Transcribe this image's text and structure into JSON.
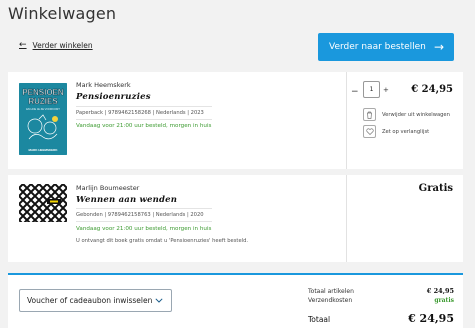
{
  "page": {
    "title": "Winkelwagen"
  },
  "nav": {
    "back_label": "Verder winkelen",
    "checkout_label": "Verder naar bestellen"
  },
  "items": [
    {
      "author": "Mark Heemskerk",
      "title": "Pensioenruzies",
      "meta": "Paperback | 9789462158268 | Nederlands | 2023",
      "delivery": "Vandaag voor 21:00 uur besteld, morgen in huis",
      "quantity": "1",
      "price": "€ 24,95",
      "remove_label": "Verwijder uit winkelwagen",
      "wishlist_label": "Zet op verlanglijst",
      "cover": {
        "line1": "PENSIOEN",
        "line2": "RUZIES",
        "subtitle": "EN HOE JE ZE VOORKOMT",
        "author": "MARK HEEMSKERK",
        "color": "#1c88a0"
      }
    },
    {
      "author": "Marlijn Boumeester",
      "title": "Wennen aan wenden",
      "meta": "Gebonden | 9789462158763 | Nederlands | 2020",
      "delivery": "Vandaag voor 21:00 uur besteld, morgen in huis",
      "price": "Gratis",
      "note": "U ontvangt dit boek gratis omdat u 'Pensioenruzies' heeft besteld."
    }
  ],
  "summary": {
    "voucher_label": "Voucher of cadeaubon inwisselen",
    "total_items_label": "Totaal artikelen",
    "total_items_value": "€ 24,95",
    "shipping_label": "Verzendkosten",
    "shipping_value": "gratis",
    "total_label": "Totaal",
    "total_value": "€ 24,95"
  },
  "colors": {
    "accent": "#1a98dd",
    "success": "#3b9a2f",
    "background": "#f2f2f2"
  }
}
